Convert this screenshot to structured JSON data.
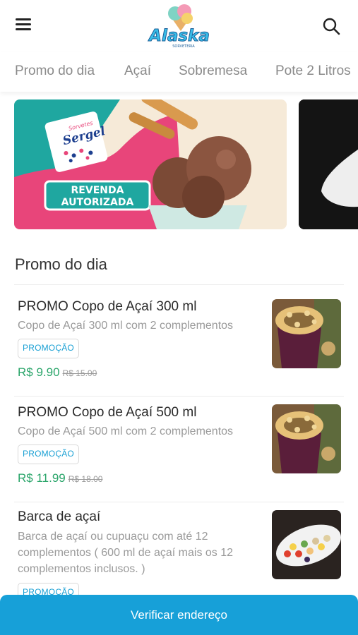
{
  "header": {
    "logo_text": "Alaska",
    "logo_subtext": "SORVETERIA",
    "menu_icon": "hamburger-menu-icon",
    "search_icon": "search-icon"
  },
  "tabs": [
    {
      "label": "Promo do dia"
    },
    {
      "label": "Açaí"
    },
    {
      "label": "Sobremesa"
    },
    {
      "label": "Pote 2 Litros"
    }
  ],
  "banner": {
    "brand_small": "Sorvetes",
    "brand": "Sergel",
    "line1": "REVENDA",
    "line2": "AUTORIZADA"
  },
  "section": {
    "title": "Promo do dia"
  },
  "products": [
    {
      "name": "PROMO Copo de Açaí 300 ml",
      "description": "Copo de Açaí 300 ml com 2 complementos",
      "badge": "PROMOÇÃO",
      "price": "R$ 9.90",
      "old_price": "R$ 15.00"
    },
    {
      "name": "PROMO Copo de Açaí 500 ml",
      "description": "Copo de Açaí 500 ml com 2 complementos",
      "badge": "PROMOÇÃO",
      "price": "R$ 11.99",
      "old_price": "R$ 18.00"
    },
    {
      "name": "Barca de açaí",
      "description": "Barca de açaí ou cupuaçu com até 12 complementos ( 600 ml de açaí mais os 12 complementos inclusos. )",
      "badge": "PROMOÇÃO"
    }
  ],
  "footer": {
    "button_label": "Verificar endereço"
  },
  "colors": {
    "accent": "#17a0d8",
    "price": "#2aa56a",
    "badge_text": "#1aa0d4",
    "banner_teal": "#1fa7a0",
    "banner_pink": "#e8457a"
  }
}
